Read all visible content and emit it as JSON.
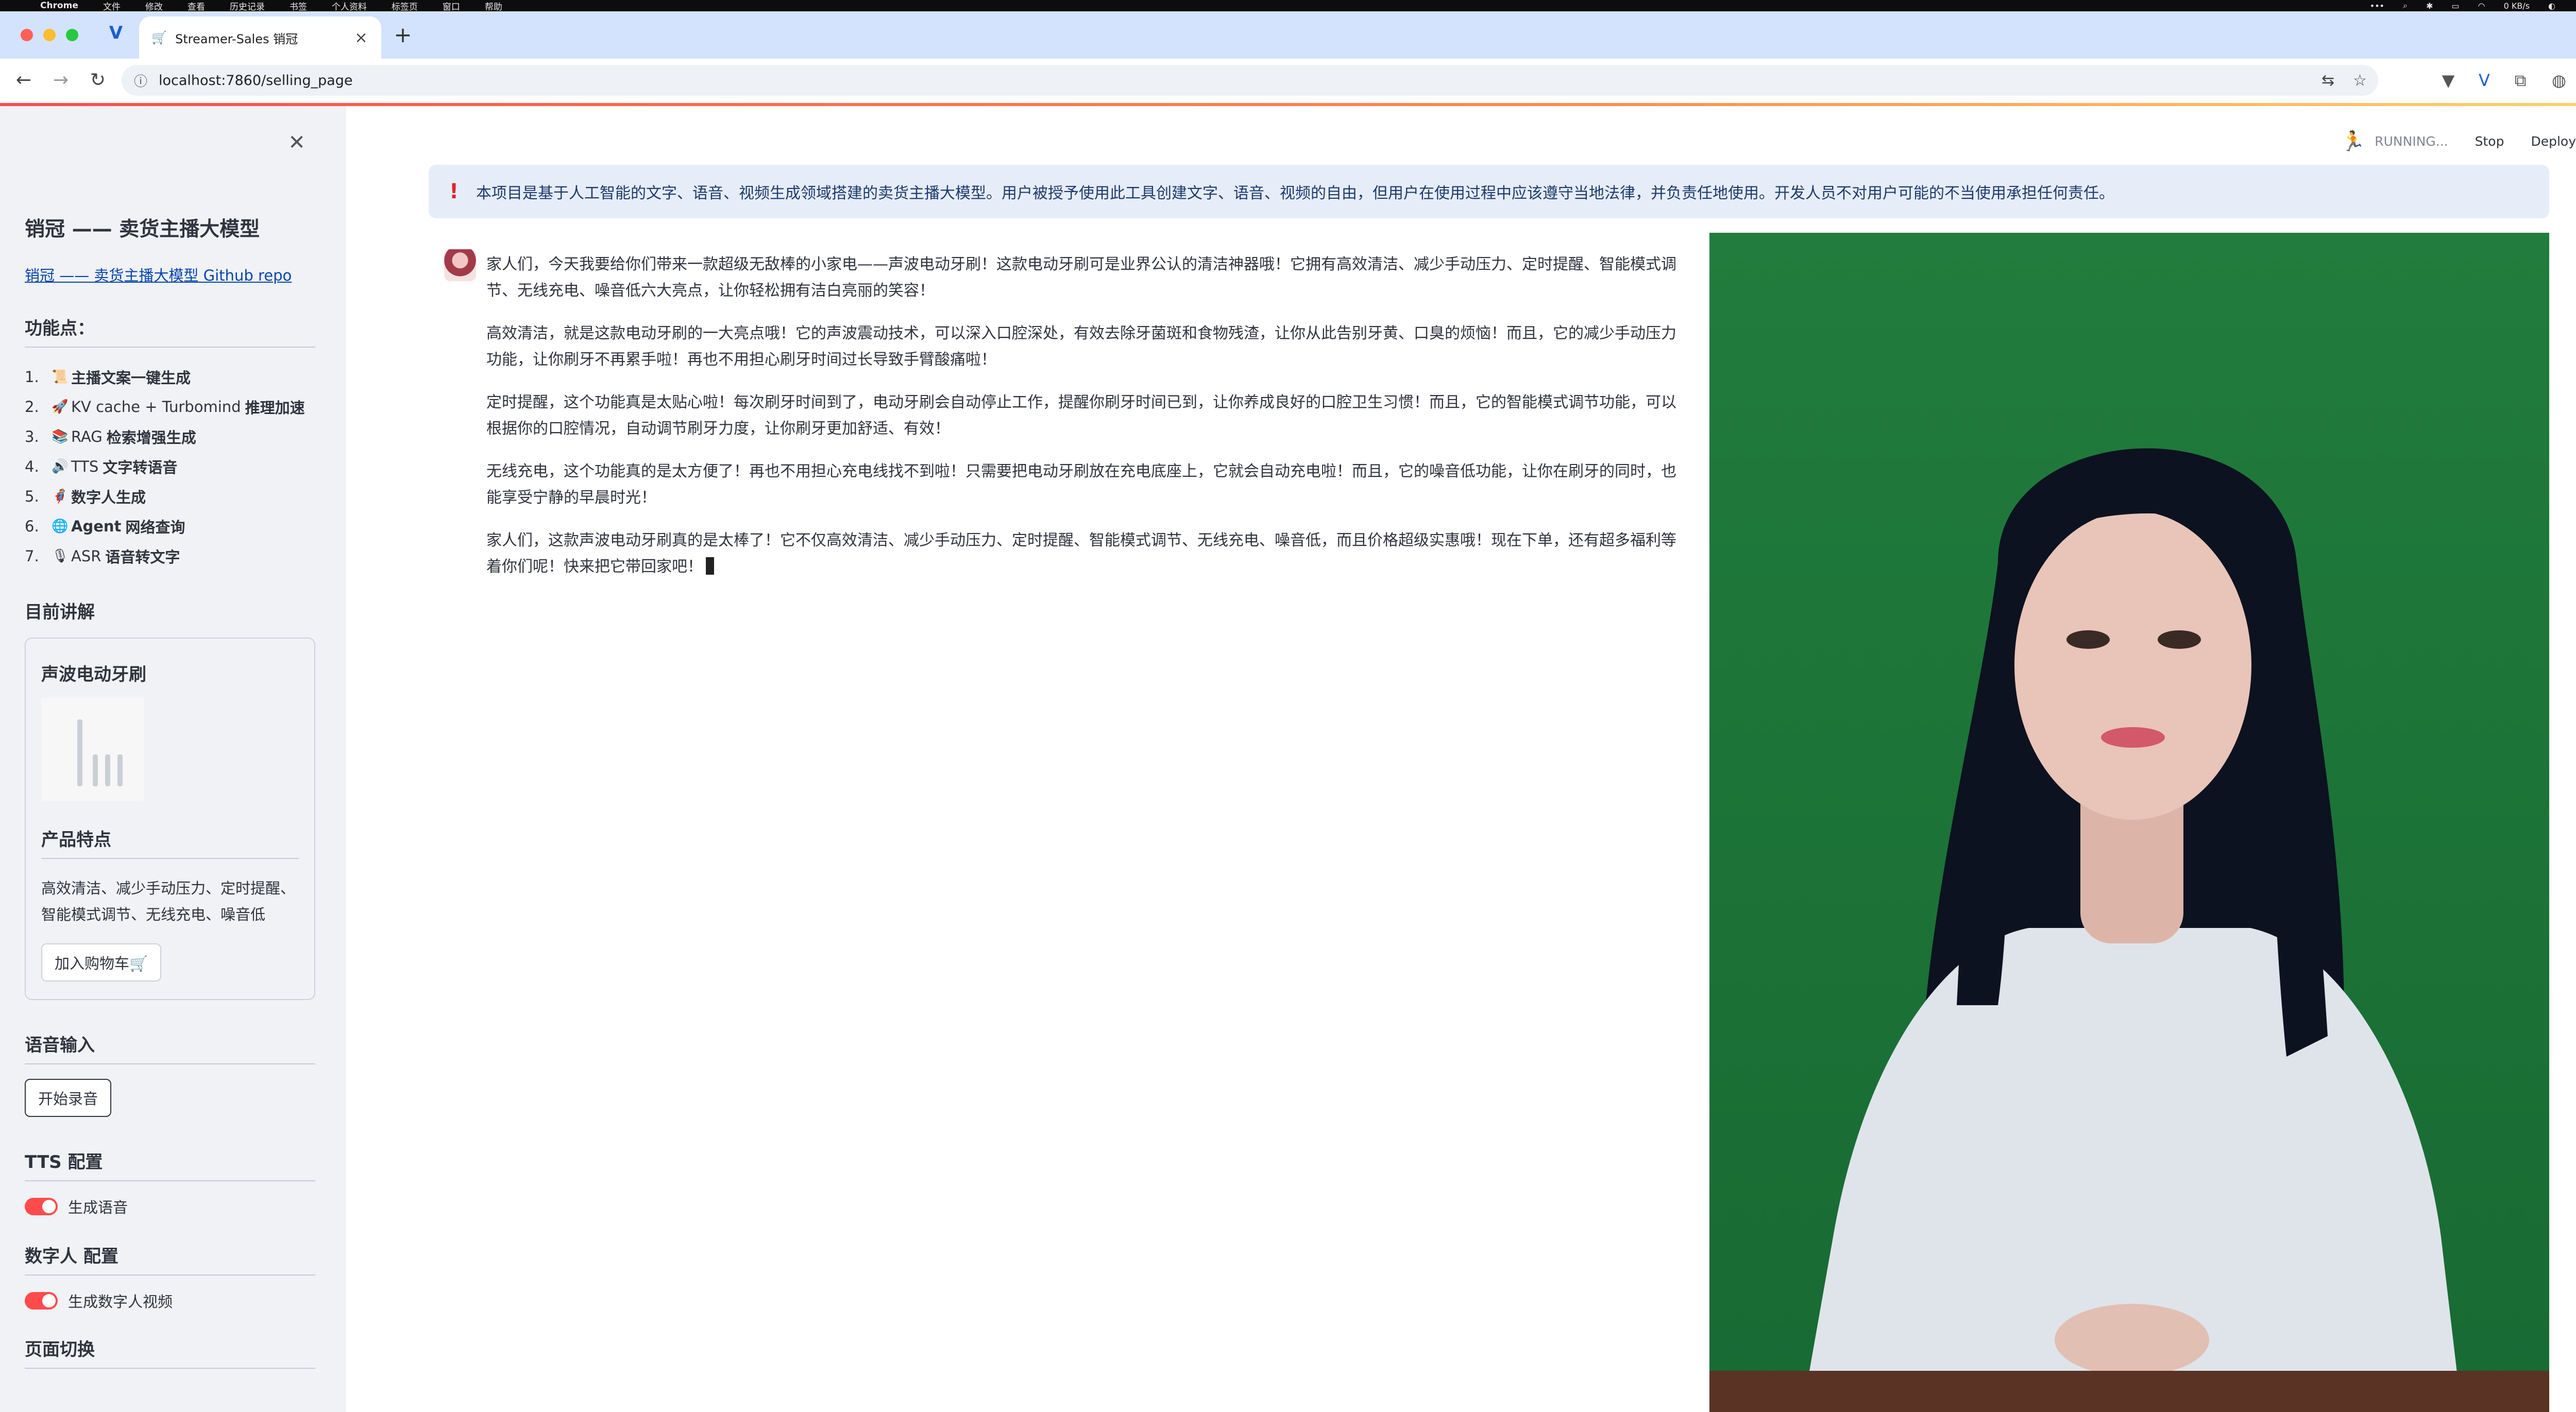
{
  "menubar": {
    "app": "Chrome",
    "items": [
      "文件",
      "修改",
      "查看",
      "历史记录",
      "书签",
      "个人资料",
      "标签页",
      "窗口",
      "帮助"
    ],
    "net_speed": "0 KB/s"
  },
  "browser": {
    "tab_title": "Streamer-Sales 销冠",
    "url": "localhost:7860/selling_page",
    "new_tab": "+",
    "tab_close": "×"
  },
  "topbar": {
    "status": "RUNNING...",
    "stop": "Stop",
    "deploy": "Deploy"
  },
  "sidebar": {
    "title": "销冠 —— 卖货主播大模型",
    "repo_link": "销冠 —— 卖货主播大模型 Github repo",
    "features_heading": "功能点：",
    "features": [
      {
        "num": "1.",
        "icon": "📜",
        "plain": "",
        "bold": "主播文案一键生成"
      },
      {
        "num": "2.",
        "icon": "🚀",
        "plain": "KV cache + Turbomind",
        "bold": "推理加速"
      },
      {
        "num": "3.",
        "icon": "📚",
        "plain": "RAG",
        "bold": "检索增强生成"
      },
      {
        "num": "4.",
        "icon": "🔊",
        "plain": "TTS",
        "bold": "文字转语音"
      },
      {
        "num": "5.",
        "icon": "🦸",
        "plain": "",
        "bold": "数字人生成"
      },
      {
        "num": "6.",
        "icon": "🌐",
        "plain": "Agent",
        "bold": "网络查询"
      },
      {
        "num": "7.",
        "icon": "🎙",
        "plain": "ASR",
        "bold": "语音转文字"
      }
    ],
    "current_heading": "目前讲解",
    "product": {
      "name": "声波电动牙刷",
      "features_heading": "产品特点",
      "features_text": "高效清洁、减少手动压力、定时提醒、智能模式调节、无线充电、噪音低",
      "add_to_cart": "加入购物车🛒"
    },
    "voice_heading": "语音输入",
    "record_button": "开始录音",
    "tts_heading": "TTS 配置",
    "tts_toggle": "生成语音",
    "digital_human_heading": "数字人 配置",
    "digital_human_toggle": "生成数字人视频",
    "page_switch_heading": "页面切换"
  },
  "alert": {
    "text": "本项目是基于人工智能的文字、语音、视频生成领域搭建的卖货主播大模型。用户被授予使用此工具创建文字、语音、视频的自由，但用户在使用过程中应该遵守当地法律，并负责任地使用。开发人员不对用户可能的不当使用承担任何责任。"
  },
  "chat": {
    "paragraphs": [
      "家人们，今天我要给你们带来一款超级无敌棒的小家电——声波电动牙刷！这款电动牙刷可是业界公认的清洁神器哦！它拥有高效清洁、减少手动压力、定时提醒、智能模式调节、无线充电、噪音低六大亮点，让你轻松拥有洁白亮丽的笑容！",
      "高效清洁，就是这款电动牙刷的一大亮点哦！它的声波震动技术，可以深入口腔深处，有效去除牙菌斑和食物残渣，让你从此告别牙黄、口臭的烦恼！而且，它的减少手动压力功能，让你刷牙不再累手啦！再也不用担心刷牙时间过长导致手臂酸痛啦！",
      "定时提醒，这个功能真是太贴心啦！每次刷牙时间到了，电动牙刷会自动停止工作，提醒你刷牙时间已到，让你养成良好的口腔卫生习惯！而且，它的智能模式调节功能，可以根据你的口腔情况，自动调节刷牙力度，让你刷牙更加舒适、有效！",
      "无线充电，这个功能真的是太方便了！再也不用担心充电线找不到啦！只需要把电动牙刷放在充电底座上，它就会自动充电啦！而且，它的噪音低功能，让你在刷牙的同时，也能享受宁静的早晨时光！",
      "家人们，这款声波电动牙刷真的是太棒了！它不仅高效清洁、减少手动压力、定时提醒、智能模式调节、无线充电、噪音低，而且价格超级实惠哦！现在下单，还有超多福利等着你们呢！快来把它带回家吧！"
    ]
  },
  "colors": {
    "accent": "#ff4b4b",
    "sidebar_bg": "#f0f2f6",
    "alert_bg": "#e6edf8",
    "video_bg": "#217c3d"
  }
}
